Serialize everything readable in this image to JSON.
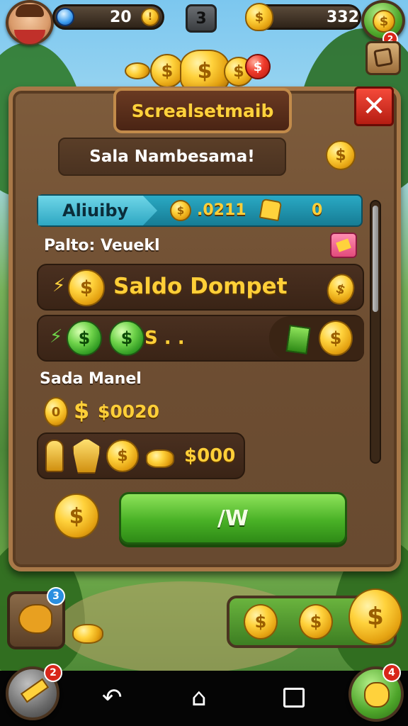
{
  "hud": {
    "gems": "20",
    "level": "3",
    "coins": "332",
    "quest_badge": "2"
  },
  "panel": {
    "title": "Screalsetmaib",
    "header": "Sala Nambesama!",
    "close_symbol": "✕",
    "tab": {
      "label": "Aliuiby",
      "value_a": ".0211",
      "value_b": "0"
    },
    "section_one_label": "Palto: Veuekl",
    "wallet_row_label": "Saldo Dompet",
    "green_row_text": "S . .",
    "section_two_label": "Sada Manel",
    "balance_amount": "$0020",
    "pile_amount": "$000",
    "action_button": "/W"
  },
  "bottom": {
    "left_badge": "3",
    "nav_left_badge": "2",
    "nav_right_badge": "4"
  },
  "colors": {
    "gold": "#ffcf38",
    "panel_wood": "#6e4e32",
    "action_green": "#49b126",
    "close_red": "#d8261a"
  }
}
